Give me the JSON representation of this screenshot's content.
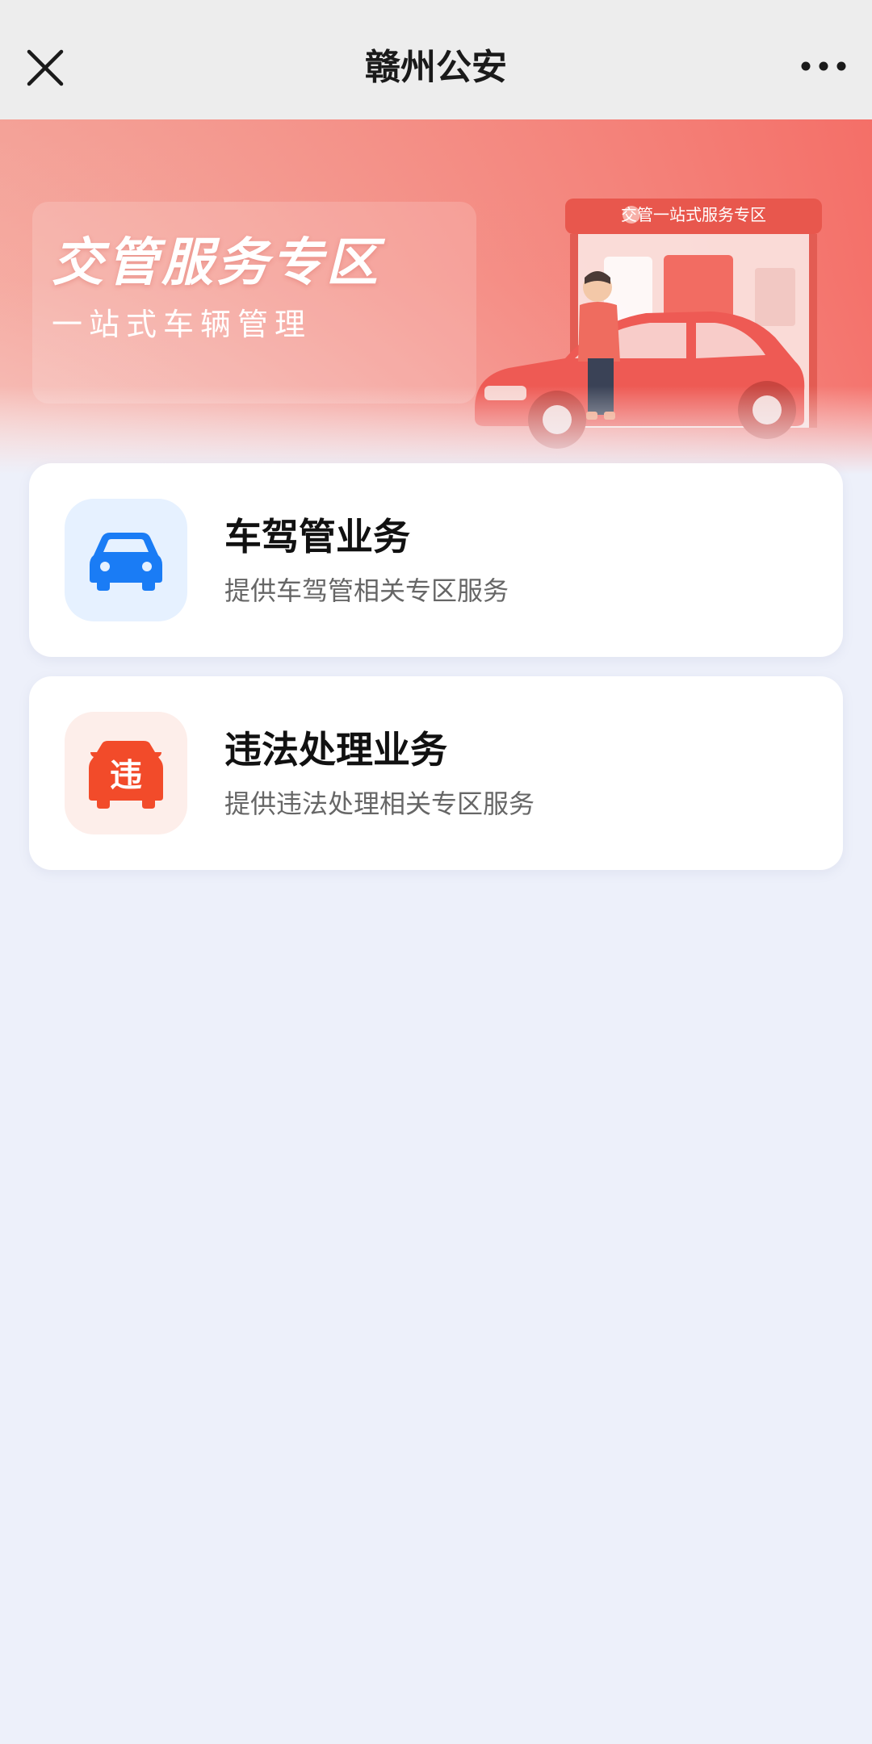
{
  "navbar": {
    "title": "赣州公安",
    "close_icon": "close-icon",
    "more_icon": "more-icon"
  },
  "banner": {
    "title": "交管服务专区",
    "subtitle": "一站式车辆管理",
    "sign_text": "交管一站式服务专区"
  },
  "services": [
    {
      "title": "车驾管业务",
      "description": "提供车驾管相关专区服务",
      "icon": "car-icon",
      "icon_color": "#1a7cf5",
      "icon_bg": "#e6f1ff"
    },
    {
      "title": "违法处理业务",
      "description": "提供违法处理相关专区服务",
      "icon": "violation-car-icon",
      "icon_label": "违",
      "icon_color": "#f24b2a",
      "icon_bg": "#fdeeea"
    }
  ]
}
